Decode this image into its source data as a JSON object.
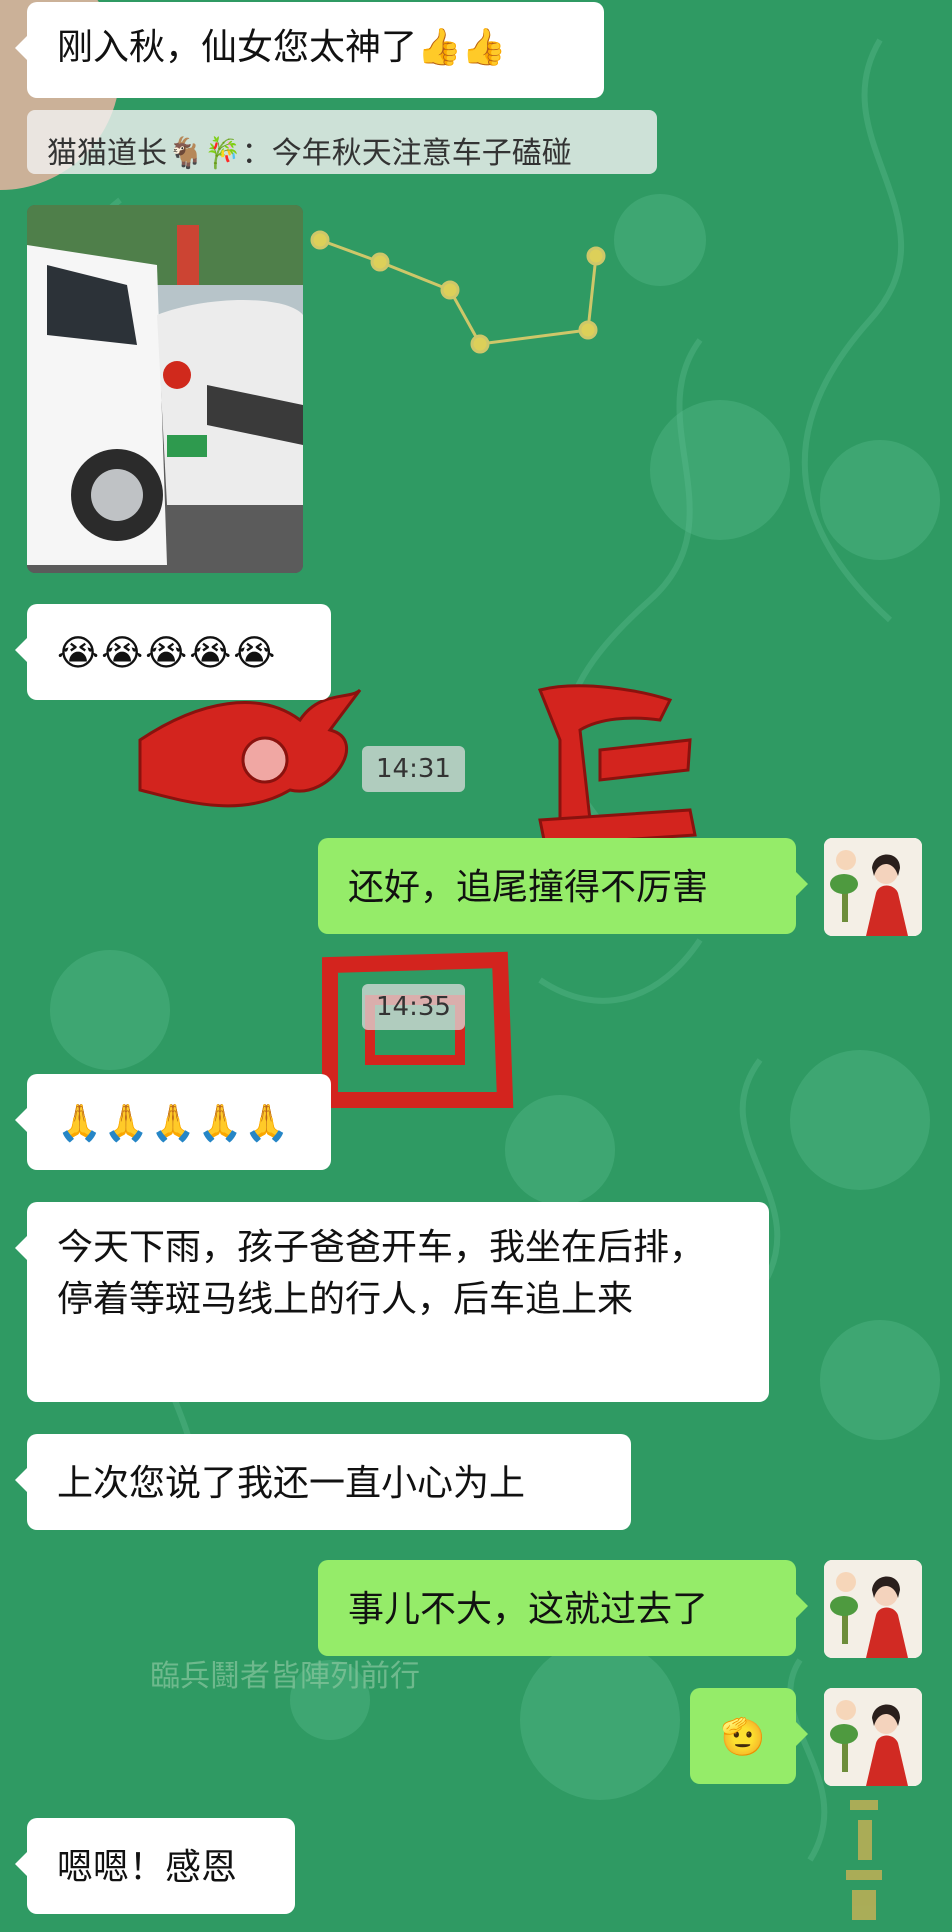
{
  "messages": [
    {
      "text": "刚入秋，仙女您太神了👍👍"
    },
    {
      "quote": "猫猫道长🐐🎋：今年秋天注意车子磕碰"
    },
    {
      "text": "😭😭😭😭😭"
    },
    {
      "time": "14:31"
    },
    {
      "text": "还好，追尾撞得不厉害"
    },
    {
      "time": "14:35"
    },
    {
      "text": "🙏🙏🙏🙏🙏"
    },
    {
      "text": "今天下雨，孩子爸爸开车，我坐在后排，停着等斑马线上的行人，后车追上来"
    },
    {
      "text": "上次您说了我还一直小心为上"
    },
    {
      "text": "事儿不大，这就过去了"
    },
    {
      "text": "🫡"
    },
    {
      "text": "嗯嗯！感恩"
    }
  ],
  "background": {
    "calligraphy_caption": "臨兵鬪者皆陣列前行"
  },
  "colors": {
    "background": "#2f9a63",
    "incoming_bubble": "#ffffff",
    "outgoing_bubble": "#95ec69",
    "calligraphy_red": "#d3241e"
  }
}
